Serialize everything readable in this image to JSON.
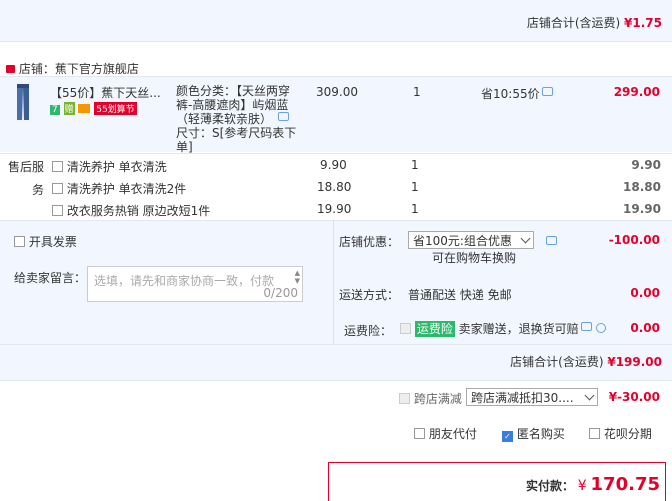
{
  "top_total": {
    "label": "店铺合计(含运费)",
    "amount": "¥1.75"
  },
  "shop": {
    "icon": "tmall",
    "name": "店铺：蕉下官方旗舰店"
  },
  "product": {
    "title": "【55价】蕉下天丝...",
    "badges": [
      "7",
      "赠",
      "55划算节"
    ],
    "spec": "颜色分类：【天丝两穿裤-高腰遮肉】屿烟蓝（轻薄柔软亲肤）",
    "size": "尺寸：S[参考尺码表下单]",
    "price": "309.00",
    "qty": "1",
    "saving": "省10:55价",
    "total": "299.00"
  },
  "services": {
    "label_a": "售后服",
    "label_b": "务",
    "items": [
      {
        "name": "清洗养护 单衣清洗",
        "price": "9.90",
        "qty": "1",
        "total": "9.90"
      },
      {
        "name": "清洗养护 单衣清洗2件",
        "price": "18.80",
        "qty": "1",
        "total": "18.80"
      },
      {
        "name": "改衣服务热销 原边改短1件",
        "price": "19.90",
        "qty": "1",
        "total": "19.90"
      }
    ]
  },
  "invoice": {
    "label": "开具发票"
  },
  "message": {
    "label": "给卖家留言：",
    "placeholder": "选填，请先和商家协商一致，付款",
    "counter": "0/200"
  },
  "discount": {
    "label": "店铺优惠：",
    "selected": "省100元:组合优惠",
    "hint": "可在购物车换购",
    "amount": "-100.00"
  },
  "shipping": {
    "label": "运送方式：",
    "value": "普通配送 快递 免邮",
    "amount": "0.00"
  },
  "insurance": {
    "label": "运费险：",
    "tag": "运费险",
    "desc": "卖家赠送，退换货可赔",
    "amount": "0.00"
  },
  "store_total": {
    "label": "店铺合计(含运费)",
    "amount": "¥199.00"
  },
  "cross_store": {
    "label": "跨店满减",
    "selected": "跨店满减抵扣30....",
    "amount": "¥-30.00"
  },
  "options": [
    {
      "label": "朋友代付",
      "checked": false
    },
    {
      "label": "匿名购买",
      "checked": true
    },
    {
      "label": "花呗分期",
      "checked": false
    }
  ],
  "payable": {
    "label": "实付款：",
    "currency": "¥",
    "amount": "170.75"
  }
}
